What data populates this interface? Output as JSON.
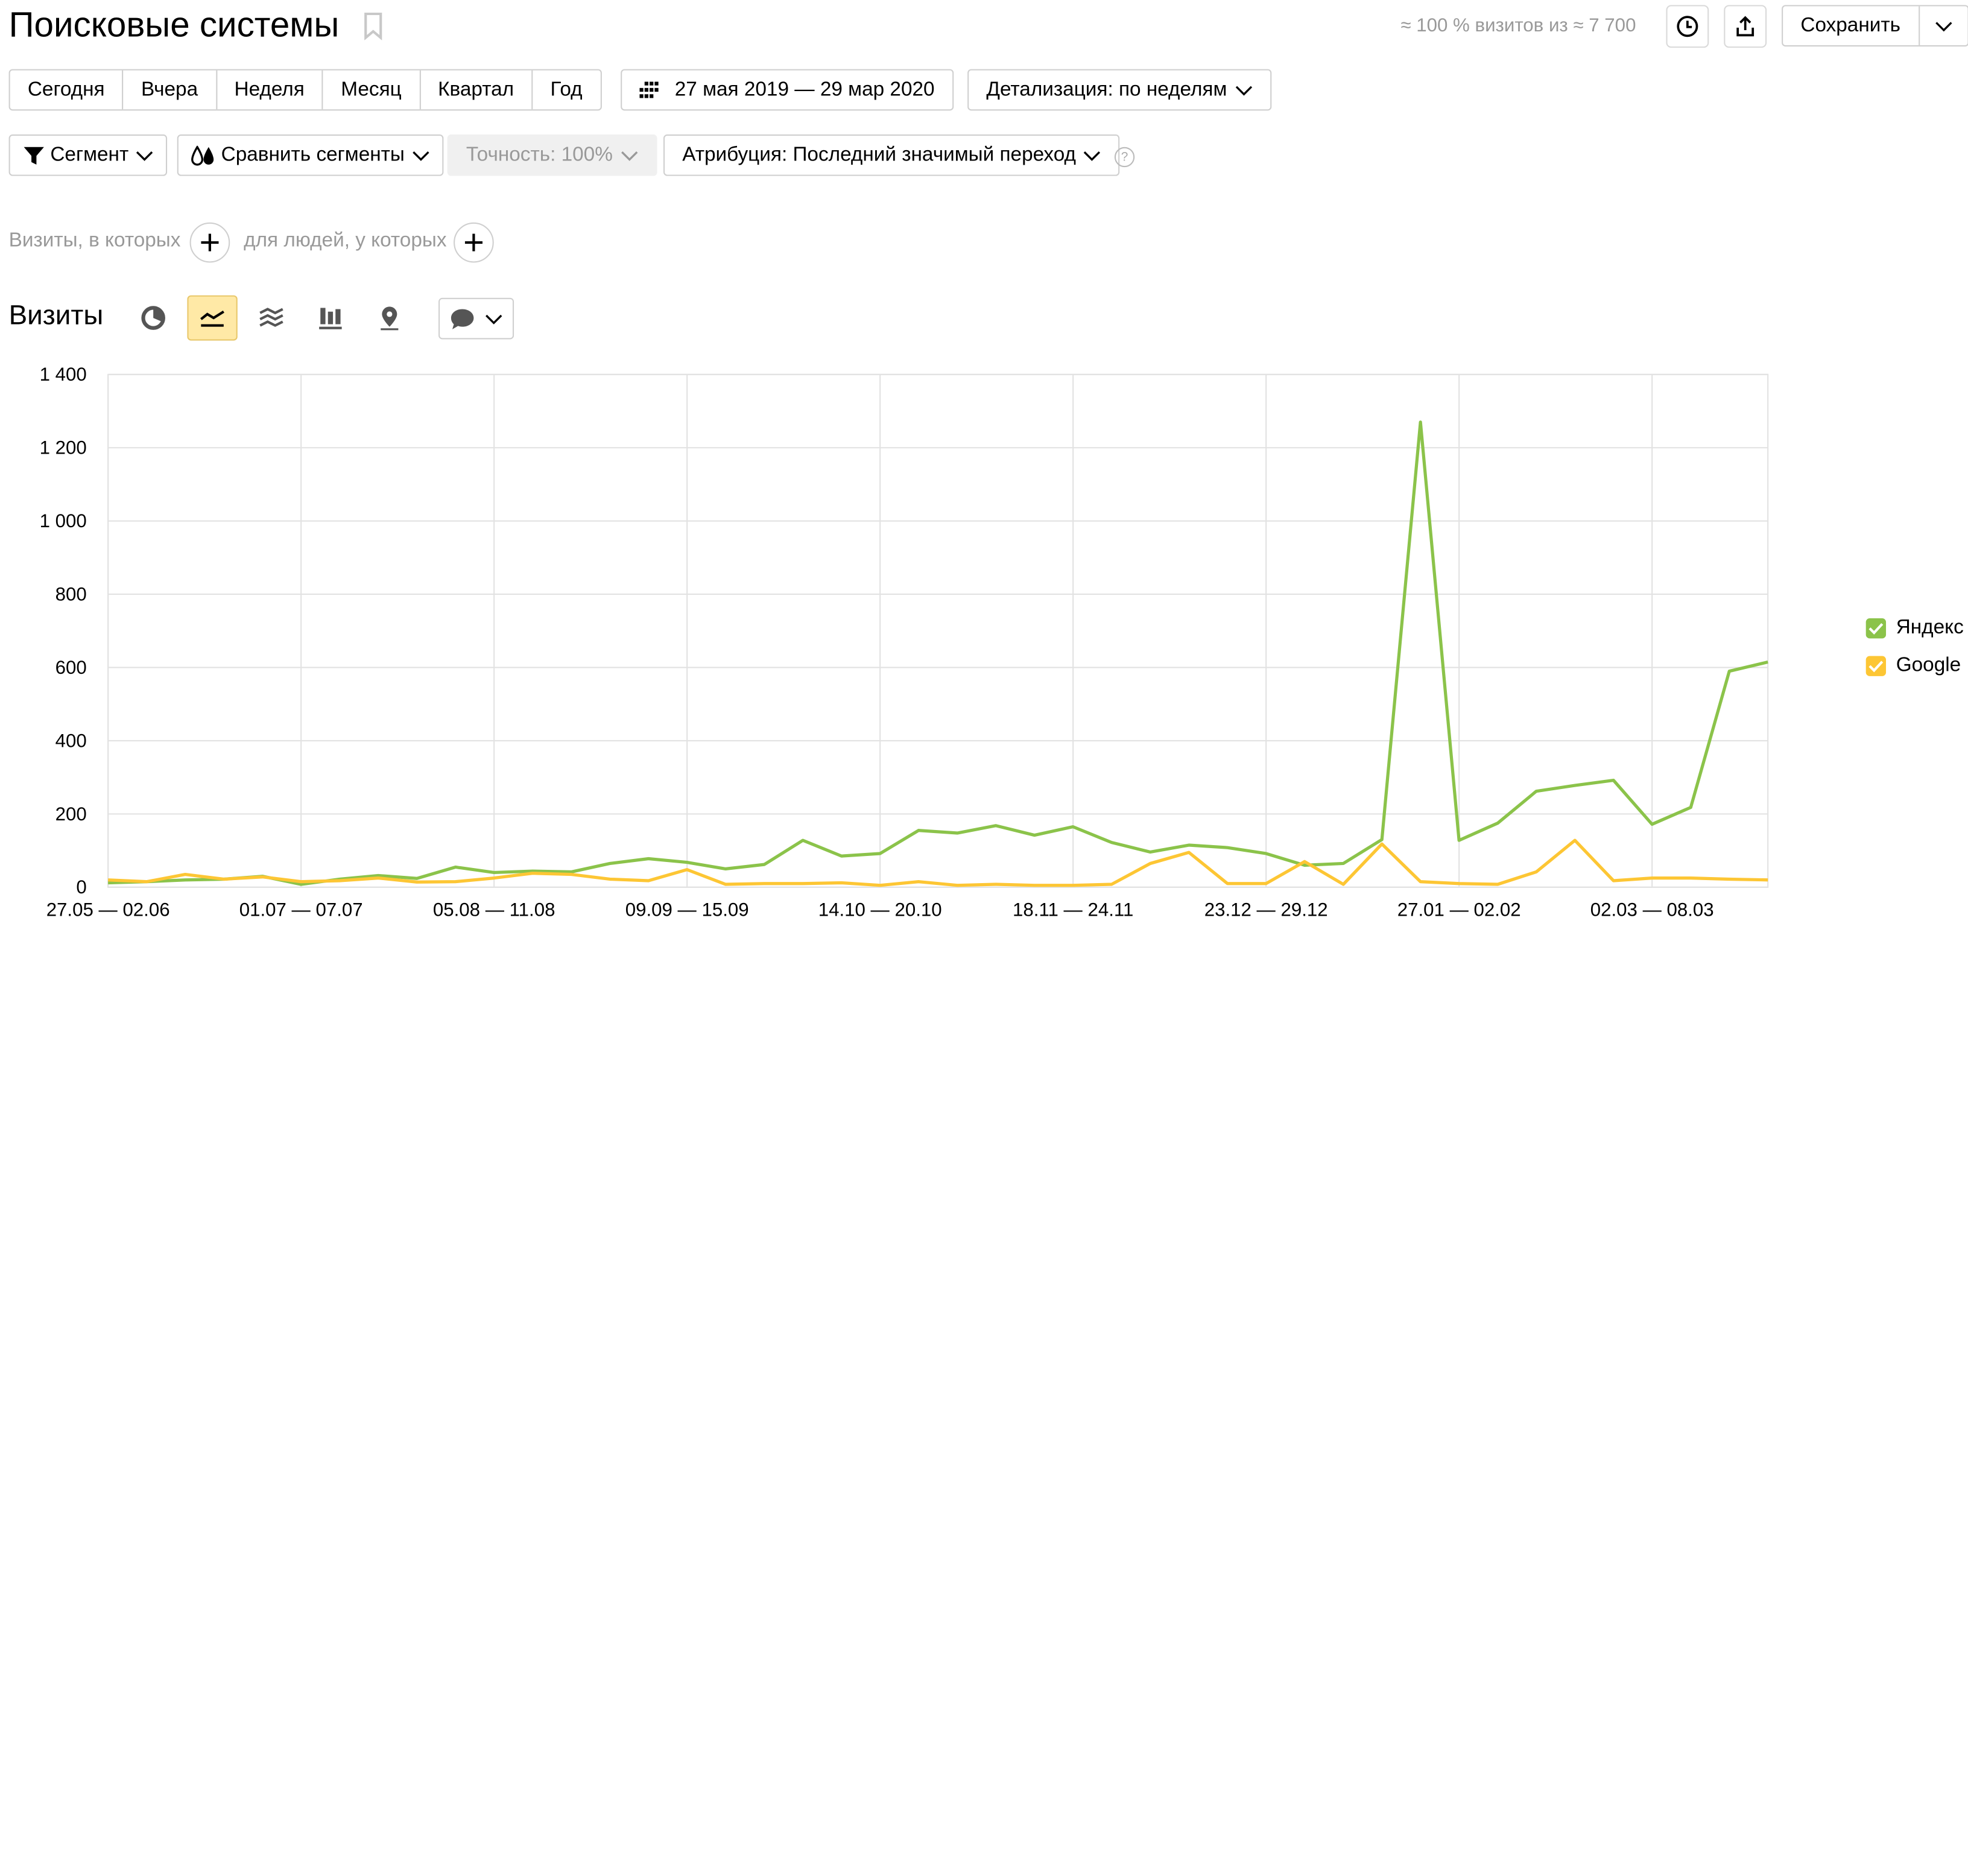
{
  "header": {
    "title": "Поисковые системы",
    "visits_info": "≈ 100 % визитов из ≈ 7 700",
    "save_label": "Сохранить"
  },
  "periods": [
    "Сегодня",
    "Вчера",
    "Неделя",
    "Месяц",
    "Квартал",
    "Год"
  ],
  "date_range": "27 мая 2019 — 29 мар 2020",
  "detail": "Детализация: по неделям",
  "segment": "Сегмент",
  "compare": "Сравнить сегменты",
  "accuracy": "Точность: 100%",
  "attribution": "Атрибуция: Последний значимый переход",
  "help": "?",
  "conditions": {
    "visits_label": "Визиты, в которых",
    "people_label": "для людей, у которых"
  },
  "metric_title": "Визиты",
  "icons": [
    "pie-chart-icon",
    "line-chart-icon",
    "area-chart-icon",
    "bar-chart-icon",
    "map-icon",
    "comment-icon",
    "chevron-down-icon",
    "history-icon",
    "share-icon",
    "bookmark-icon",
    "calendar-icon",
    "filter-icon",
    "segments-icon"
  ],
  "colors": {
    "yandex": "#8bc34a",
    "google": "#fdc634",
    "active_tool": "#ffe9a6"
  },
  "chart_data": {
    "type": "line",
    "title": "",
    "xlabel": "",
    "ylabel": "",
    "ylim": [
      0,
      1400
    ],
    "yticks": [
      0,
      200,
      400,
      600,
      800,
      1000,
      1200,
      1400
    ],
    "ytick_labels": [
      "0",
      "200",
      "400",
      "600",
      "800",
      "1 000",
      "1 200",
      "1 400"
    ],
    "xtick_labels": [
      "27.05 — 02.06",
      "01.07 — 07.07",
      "05.08 — 11.08",
      "09.09 — 15.09",
      "14.10 — 20.10",
      "18.11 — 24.11",
      "23.12 — 29.12",
      "27.01 — 02.02",
      "02.03 — 08.03"
    ],
    "xtick_index": [
      0,
      5,
      10,
      15,
      20,
      25,
      30,
      35,
      40
    ],
    "n_points": 44,
    "grid": true,
    "legend_position": "right",
    "series": [
      {
        "name": "Яндекс",
        "color": "#8bc34a",
        "values": [
          12,
          15,
          20,
          22,
          30,
          8,
          22,
          32,
          24,
          55,
          40,
          44,
          42,
          65,
          78,
          68,
          50,
          62,
          128,
          85,
          92,
          155,
          148,
          168,
          142,
          165,
          122,
          96,
          115,
          108,
          92,
          60,
          65,
          130,
          1270,
          128,
          175,
          262,
          278,
          292,
          172,
          218,
          590,
          615
        ]
      },
      {
        "name": "Google",
        "color": "#fdc634",
        "values": [
          20,
          15,
          35,
          22,
          28,
          15,
          18,
          25,
          14,
          15,
          25,
          38,
          35,
          22,
          18,
          48,
          8,
          10,
          10,
          12,
          5,
          15,
          5,
          8,
          5,
          5,
          8,
          65,
          95,
          10,
          10,
          70,
          8,
          118,
          15,
          10,
          8,
          42,
          128,
          18,
          25,
          25,
          22,
          20
        ]
      }
    ]
  }
}
